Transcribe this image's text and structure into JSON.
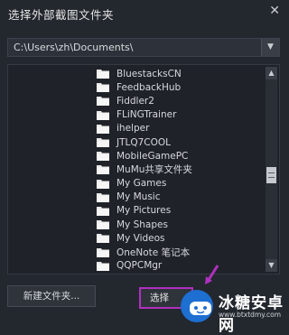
{
  "dialog": {
    "title": "选择外部截图文件夹",
    "close_glyph": "✕"
  },
  "path": {
    "value": "C:\\Users\\zh\\Documents\\",
    "dropdown_glyph": "▼"
  },
  "folders": [
    "BluestacksCN",
    "FeedbackHub",
    "Fiddler2",
    "FLiNGTrainer",
    "ihelper",
    "JTLQ7COOL",
    "MobileGamePC",
    "MuMu共享文件夹",
    "My Games",
    "My Music",
    "My Pictures",
    "My Shapes",
    "My Videos",
    "OneNote 笔记本",
    "QQPCMgr"
  ],
  "scrollbar": {
    "up_glyph": "▲",
    "down_glyph": "▼",
    "thumb_position": 0.5
  },
  "buttons": {
    "new_folder": "新建文件夹...",
    "select": "选择"
  },
  "watermark": {
    "name": "冰糖安卓网",
    "url": "www.btxtdmy.com"
  },
  "colors": {
    "background": "#23272e",
    "highlight_border": "#b030c0",
    "watermark_blue": "#1d6fd1"
  }
}
